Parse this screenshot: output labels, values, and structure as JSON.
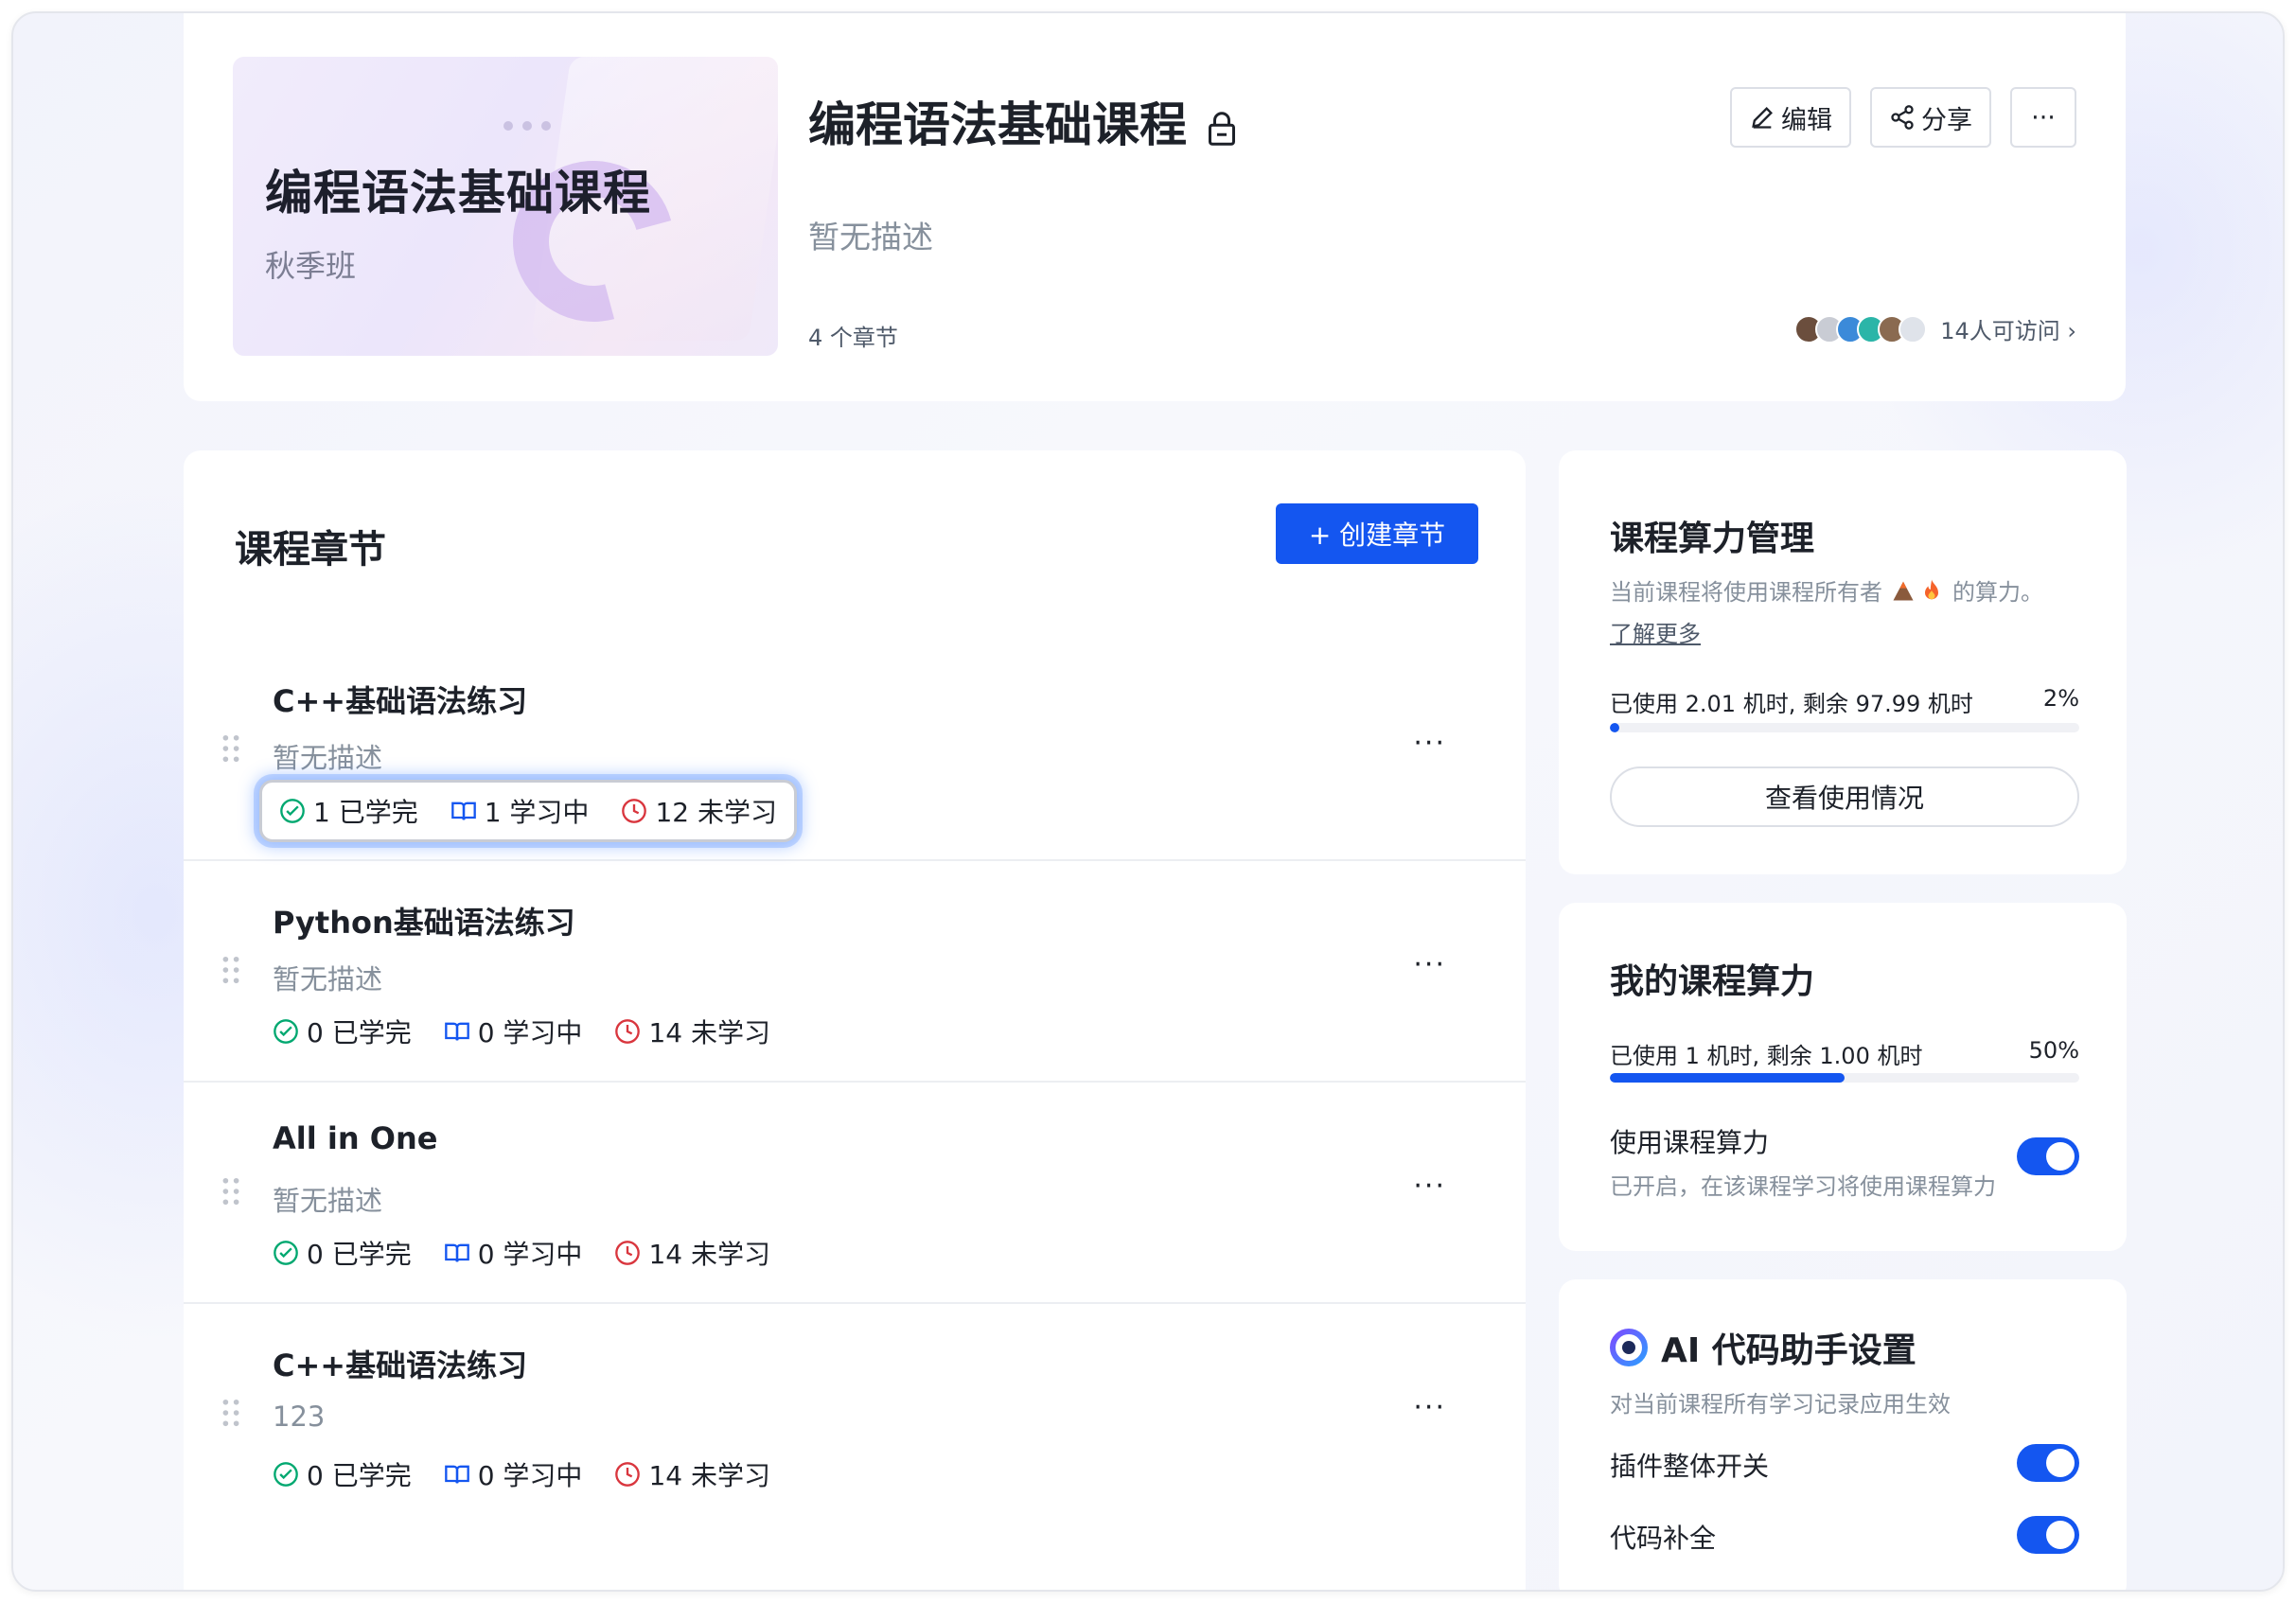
{
  "header": {
    "cover_title": "编程语法基础课程",
    "cover_subtitle": "秋季班",
    "title": "编程语法基础课程",
    "description": "暂无描述",
    "chapter_count": "4 个章节",
    "edit_label": "编辑",
    "share_label": "分享",
    "more_label": "···",
    "visitors_label": "14人可访问 ›"
  },
  "chapters_panel": {
    "title": "课程章节",
    "create_label": "+ 创建章节",
    "chapters": [
      {
        "title": "C++基础语法练习",
        "desc": "暂无描述",
        "done": "1 已学完",
        "learning": "1 学习中",
        "todo": "12 未学习"
      },
      {
        "title": "Python基础语法练习",
        "desc": "暂无描述",
        "done": "0 已学完",
        "learning": "0 学习中",
        "todo": "14 未学习"
      },
      {
        "title": "All in One",
        "desc": "暂无描述",
        "done": "0 已学完",
        "learning": "0 学习中",
        "todo": "14 未学习"
      },
      {
        "title": "C++基础语法练习",
        "desc": "123",
        "done": "0 已学完",
        "learning": "0 学习中",
        "todo": "14 未学习"
      }
    ],
    "more_label": "···"
  },
  "compute_mgmt": {
    "title": "课程算力管理",
    "text_prefix": "当前课程将使用课程所有者",
    "text_suffix": "的算力。",
    "learn_more": "了解更多",
    "usage": "已使用 2.01 机时, 剩余 97.99 机时",
    "percent": "2%",
    "progress": 0.02,
    "view_usage": "查看使用情况"
  },
  "my_compute": {
    "title": "我的课程算力",
    "usage": "已使用 1 机时, 剩余 1.00 机时",
    "percent": "50%",
    "progress": 0.5,
    "use_label": "使用课程算力",
    "use_desc": "已开启，在该课程学习将使用课程算力"
  },
  "ai_settings": {
    "title": "AI 代码助手设置",
    "desc": "对当前课程所有学习记录应用生效",
    "plugin_switch": "插件整体开关",
    "code_completion": "代码补全"
  },
  "colors": {
    "primary": "#1456f0",
    "done": "#00a870",
    "learning": "#1456f0",
    "todo": "#d9363e"
  }
}
